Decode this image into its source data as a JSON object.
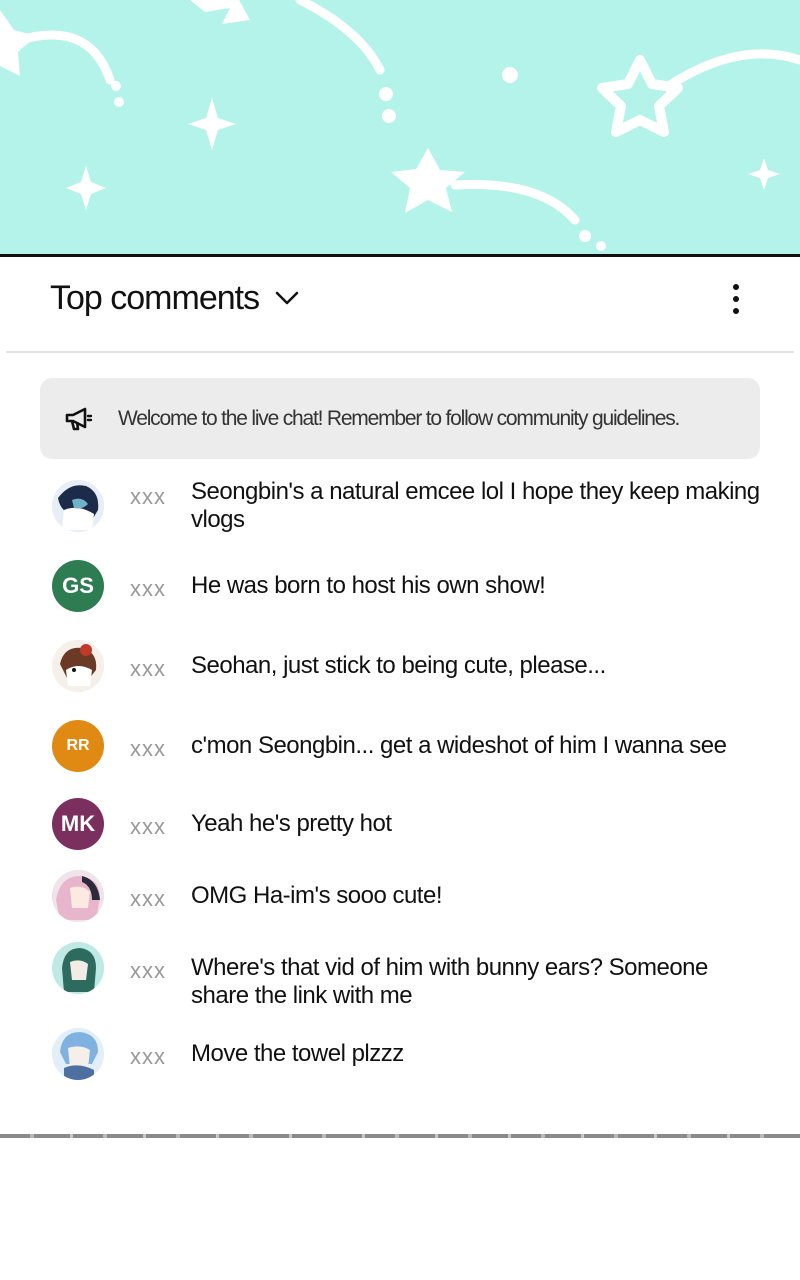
{
  "header": {
    "title": "Top comments",
    "chevron_icon": "chevron-down-icon",
    "menu_icon": "more-vertical-icon"
  },
  "notice": {
    "icon": "megaphone-icon",
    "text": "Welcome to the live chat! Remember to follow community guidelines."
  },
  "colors": {
    "banner": "#b4f3e9",
    "notice_bg": "#ececec",
    "username": "#9a9a9a",
    "avatar_gs": "#2e7d52",
    "avatar_rr": "#e08a14",
    "avatar_mk": "#7b2f5e"
  },
  "comments": [
    {
      "avatar": "image",
      "user": "xxx",
      "text": "Seongbin's a natural emcee lol I hope they keep making vlogs"
    },
    {
      "avatar": "GS",
      "user": "xxx",
      "text": "He was born to host his own show!"
    },
    {
      "avatar": "image",
      "user": "xxx",
      "text": "Seohan, just stick to being cute, please..."
    },
    {
      "avatar": "RR",
      "user": "xxx",
      "text": "c'mon Seongbin... get a wideshot of him I wanna see"
    },
    {
      "avatar": "MK",
      "user": "xxx",
      "text": "Yeah he's pretty hot"
    },
    {
      "avatar": "image",
      "user": "xxx",
      "text": "OMG Ha-im's sooo cute!"
    },
    {
      "avatar": "image",
      "user": "xxx",
      "text": "Where's that vid of him with bunny ears? Someone share the link with me"
    },
    {
      "avatar": "image",
      "user": "xxx",
      "text": "Move the towel plzzz"
    }
  ]
}
